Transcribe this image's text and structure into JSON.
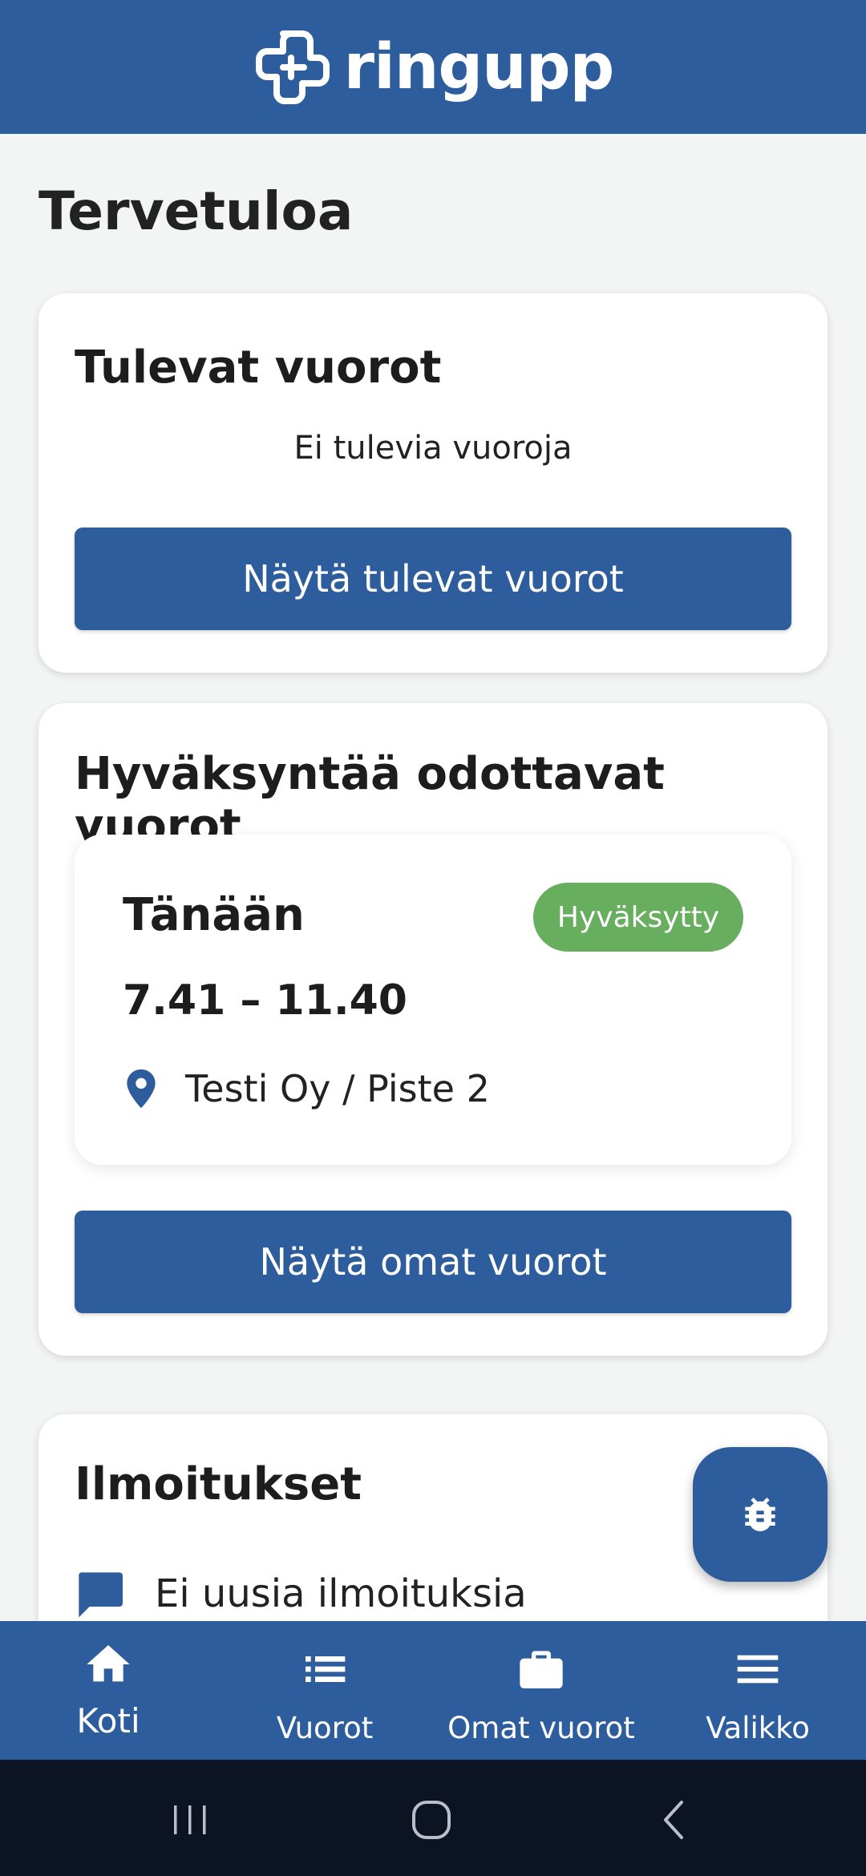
{
  "header": {
    "brand": "ringupp",
    "logo_icon": "ringupp-logo-icon"
  },
  "welcome_title": "Tervetuloa",
  "upcoming": {
    "title": "Tulevat vuorot",
    "empty_text": "Ei tulevia vuoroja",
    "button_label": "Näytä tulevat vuorot"
  },
  "pending": {
    "title": "Hyväksyntää odottavat vuorot",
    "shift": {
      "day": "Tänään",
      "status": "Hyväksytty",
      "status_color": "#67ae5e",
      "time": "7.41 – 11.40",
      "location": "Testi Oy / Piste 2",
      "location_icon": "map-pin-icon"
    },
    "button_label": "Näytä omat vuorot"
  },
  "notifications": {
    "title": "Ilmoitukset",
    "empty_text": "Ei uusia ilmoituksia",
    "icon": "chat-bubble-icon"
  },
  "fab": {
    "icon": "bug-icon"
  },
  "bottom_nav": {
    "items": [
      {
        "label": "Koti",
        "icon": "home-icon",
        "active": true
      },
      {
        "label": "Vuorot",
        "icon": "list-icon",
        "active": false
      },
      {
        "label": "Omat vuorot",
        "icon": "briefcase-icon",
        "active": false
      },
      {
        "label": "Valikko",
        "icon": "menu-icon",
        "active": false
      }
    ]
  },
  "colors": {
    "primary": "#2d5d9c",
    "background": "#f3f4f4",
    "system_bar": "#0c1322"
  }
}
